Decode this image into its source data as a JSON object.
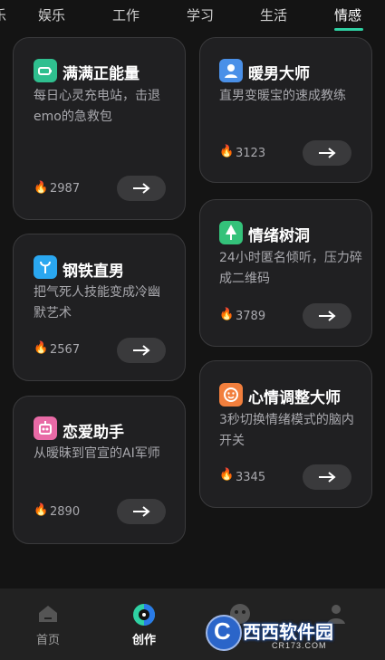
{
  "tabs": [
    "乐",
    "娱乐",
    "工作",
    "学习",
    "生活",
    "情感"
  ],
  "active_tab": "情感",
  "colors": {
    "accent": "#2fd1a3",
    "card_bg": "#202022",
    "fire": "#ff7a1a"
  },
  "cards": [
    {
      "title": "满满正能量",
      "desc": "每日心灵充电站，击退emo的急救包",
      "count": "2987",
      "icon": "recharge-icon",
      "icon_color": "#2fbf8f"
    },
    {
      "title": "暖男大师",
      "desc": "直男变暖宝的速成教练",
      "count": "3123",
      "icon": "person-icon",
      "icon_color": "#4a90e8"
    },
    {
      "title": "钢铁直男",
      "desc": "把气死人技能变成冷幽默艺术",
      "count": "2567",
      "icon": "fork-icon",
      "icon_color": "#2aa7f0"
    },
    {
      "title": "情绪树洞",
      "desc": "24小时匿名倾听，压力碎成二维码",
      "count": "3789",
      "icon": "tree-icon",
      "icon_color": "#34c27a"
    },
    {
      "title": "恋爱助手",
      "desc": "从暧昧到官宣的AI军师",
      "count": "2890",
      "icon": "love-icon",
      "icon_color": "#e86aa6"
    },
    {
      "title": "心情调整大师",
      "desc": "3秒切换情绪模式的脑内开关",
      "count": "3345",
      "icon": "smile-icon",
      "icon_color": "#f27f3d"
    }
  ],
  "bottom_nav": [
    {
      "label": "首页",
      "icon": "home-icon"
    },
    {
      "label": "创作",
      "icon": "create-icon",
      "active": true
    },
    {
      "label": "",
      "icon": "discover-icon"
    },
    {
      "label": "",
      "icon": "profile-icon"
    }
  ],
  "watermark": {
    "brand": "西西软件园",
    "url": "CR173.COM"
  }
}
